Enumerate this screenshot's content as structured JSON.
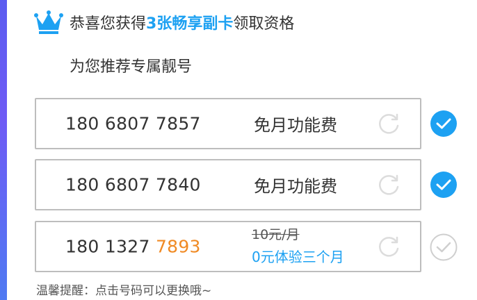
{
  "header": {
    "prefix": "恭喜您获得",
    "highlight": "3张畅享副卡",
    "suffix": "领取资格",
    "icon": "crown-icon"
  },
  "subtitle": "为您推荐专属靓号",
  "numbers": [
    {
      "main": "180 6807 7857",
      "tail": "",
      "fee": "免月功能费",
      "selected": true
    },
    {
      "main": "180 6807 7840",
      "tail": "",
      "fee": "免月功能费",
      "selected": true
    },
    {
      "main": "180 1327 ",
      "tail": "7893",
      "old_price": "10元/月",
      "promo": "0元体验三个月",
      "selected": false
    }
  ],
  "tip": "温馨提醒：点击号码可以更换哦~",
  "colors": {
    "accent": "#1da1f2",
    "tail_highlight": "#f08a24",
    "border": "#bdbdbd"
  }
}
